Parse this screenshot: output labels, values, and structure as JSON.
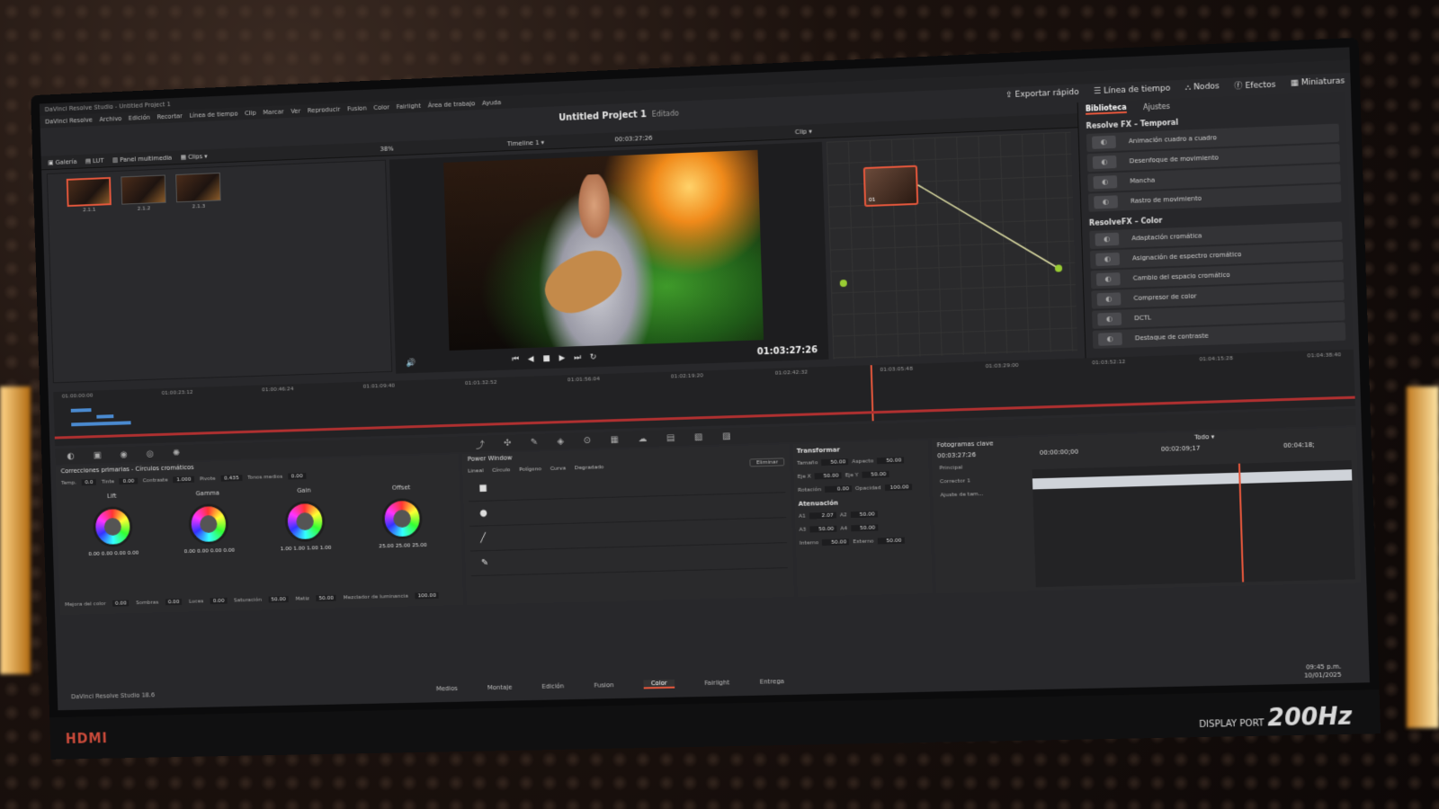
{
  "window": {
    "title": "DaVinci Resolve Studio - Untitled Project 1",
    "menu": [
      "DaVinci Resolve",
      "Archivo",
      "Edición",
      "Recortar",
      "Línea de tiempo",
      "Clip",
      "Marcar",
      "Ver",
      "Reproducir",
      "Fusion",
      "Color",
      "Fairlight",
      "Área de trabajo",
      "Ayuda"
    ]
  },
  "topbar": {
    "project": "Untitled Project 1",
    "status": "Editado",
    "quick_export": "Exportar rápido",
    "timeline_tab": "Línea de tiempo",
    "nodes_tab": "Nodos",
    "effects_tab": "Efectos",
    "thumbs_tab": "Miniaturas"
  },
  "toolbar": {
    "gallery": "Galería",
    "lut": "LUT",
    "media_panel": "Panel multimedia",
    "clips": "Clips",
    "zoom": "38%",
    "timeline_name": "Timeline 1",
    "timecode": "00:03:27:26",
    "clip_mode": "Clip"
  },
  "media": {
    "clips": [
      {
        "label": "2.1.1"
      },
      {
        "label": "2.1.2"
      },
      {
        "label": "2.1.3"
      }
    ]
  },
  "viewer": {
    "timecode": "01:03:27:26"
  },
  "nodes": {
    "node_label": "01"
  },
  "library": {
    "tabs": [
      "Biblioteca",
      "Ajustes"
    ],
    "groups": [
      {
        "title": "Resolve FX – Temporal",
        "items": [
          "Animación cuadro a cuadro",
          "Desenfoque de movimiento",
          "Mancha",
          "Rastro de movimiento"
        ]
      },
      {
        "title": "ResolveFX – Color",
        "items": [
          "Adaptación cromática",
          "Asignación de espectro cromático",
          "Cambio del espacio cromático",
          "Compresor de color",
          "DCTL",
          "Destaque de contraste"
        ]
      }
    ]
  },
  "timeline": {
    "marks": [
      "01:00:00:00",
      "01:00:23:12",
      "01:00:46:24",
      "01:01:09:40",
      "01:01:32:52",
      "01:01:56:04",
      "01:02:19:20",
      "01:02:42:32",
      "01:03:05:48",
      "01:03:29:00",
      "01:03:52:12",
      "01:04:15:28",
      "01:04:38:40"
    ]
  },
  "primaries": {
    "title": "Correcciones primarias - Círculos cromáticos",
    "params": [
      {
        "k": "Temp.",
        "v": "0.0"
      },
      {
        "k": "Tinte",
        "v": "0.00"
      },
      {
        "k": "Contraste",
        "v": "1.000"
      },
      {
        "k": "Pivote",
        "v": "0.435"
      },
      {
        "k": "Tonos medios",
        "v": "0.00"
      }
    ],
    "wheels": [
      {
        "name": "Lift",
        "vals": "0.00 0.00 0.00 0.00"
      },
      {
        "name": "Gamma",
        "vals": "0.00 0.00 0.00 0.00"
      },
      {
        "name": "Gain",
        "vals": "1.00 1.00 1.00 1.00"
      },
      {
        "name": "Offset",
        "vals": "25.00 25.00 25.00"
      }
    ],
    "bottom": [
      {
        "k": "Mejora del color",
        "v": "0.00"
      },
      {
        "k": "Sombras",
        "v": "0.00"
      },
      {
        "k": "Luces",
        "v": "0.00"
      },
      {
        "k": "Saturación",
        "v": "50.00"
      },
      {
        "k": "Matiz",
        "v": "50.00"
      },
      {
        "k": "Mezclador de luminancia",
        "v": "100.00"
      }
    ]
  },
  "power_window": {
    "title": "Power Window",
    "shapes": [
      "Lineal",
      "Círculo",
      "Polígono",
      "Curva",
      "Degradado"
    ],
    "delete": "Eliminar",
    "rows": [
      "■",
      "●",
      "╱",
      "✎"
    ]
  },
  "transform": {
    "title": "Transformar",
    "rows": [
      {
        "k1": "Tamaño",
        "v1": "50.00",
        "k2": "Aspecto",
        "v2": "50.00"
      },
      {
        "k1": "Eje X",
        "v1": "50.00",
        "k2": "Eje Y",
        "v2": "50.00"
      },
      {
        "k1": "Rotación",
        "v1": "0.00",
        "k2": "Opacidad",
        "v2": "100.00"
      }
    ],
    "soft_title": "Atenuación",
    "soft": [
      {
        "k1": "A1",
        "v1": "2.07",
        "k2": "A2",
        "v2": "50.00"
      },
      {
        "k1": "A3",
        "v1": "50.00",
        "k2": "A4",
        "v2": "50.00"
      },
      {
        "k1": "Interno",
        "v1": "50.00",
        "k2": "Externo",
        "v2": "50.00"
      }
    ]
  },
  "keyframes": {
    "title": "Fotogramas clave",
    "filter": "Todo",
    "timecode": "00:03:27:26",
    "ticks": [
      "00:00:00;00",
      "00:02:09;17",
      "00:04:18;"
    ],
    "tracks": [
      "Principal",
      "Corrector 1",
      "Ajuste de tam..."
    ]
  },
  "pages": [
    "Medios",
    "Montaje",
    "Edición",
    "Fusion",
    "Color",
    "Fairlight",
    "Entrega"
  ],
  "active_page": "Color",
  "footer": {
    "app": "DaVinci Resolve Studio 18.6"
  },
  "clock": {
    "time": "09:45 p.m.",
    "date": "10/01/2025"
  },
  "monitor": {
    "brand": "HDMI",
    "port": "DISPLAY PORT",
    "hz": "200Hz"
  }
}
